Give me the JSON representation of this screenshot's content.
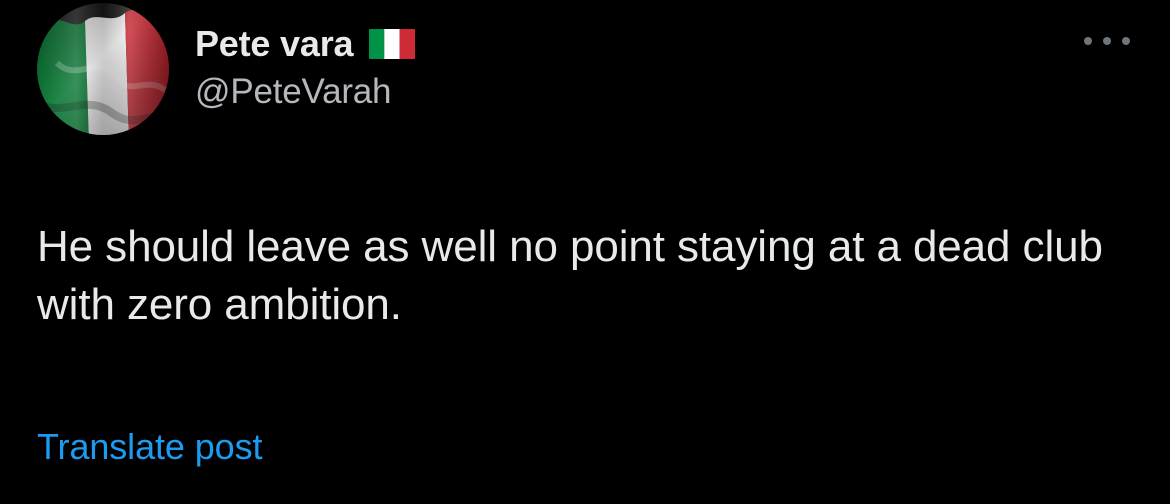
{
  "post": {
    "author": {
      "display_name": "Pete vara",
      "badge_icon": "italy-flag-icon",
      "handle": "@PeteVarah",
      "avatar_icon": "italy-flag-avatar"
    },
    "more_icon": "more-horizontal-icon",
    "text": "He should leave as well no point staying at a dead club with zero ambition.",
    "translate_label": "Translate post"
  },
  "colors": {
    "background": "#000000",
    "primary_text": "#e7e9ea",
    "secondary_text": "#b4b8bd",
    "link": "#1d9bf0",
    "flag_green": "#009246",
    "flag_white": "#ffffff",
    "flag_red": "#ce2b37"
  }
}
